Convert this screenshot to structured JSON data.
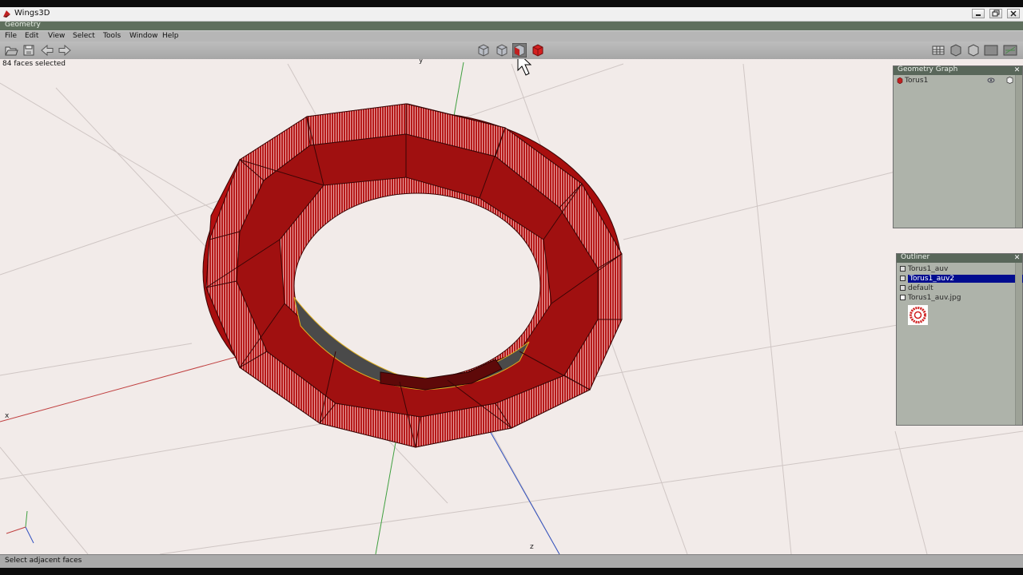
{
  "window": {
    "title": "Wings3D"
  },
  "mode": {
    "label": "Geometry"
  },
  "menu": [
    "File",
    "Edit",
    "View",
    "Select",
    "Tools",
    "Window",
    "Help"
  ],
  "toolbar": {
    "left_icons": [
      "open-icon",
      "save-icon",
      "undo-icon",
      "redo-icon"
    ],
    "selection_modes": [
      "vertex-mode",
      "edge-mode",
      "face-mode",
      "body-mode"
    ],
    "right_icons": [
      "grid-icon",
      "smooth-shade-icon",
      "wireframe-icon",
      "xray-icon",
      "axes-icon"
    ]
  },
  "viewport": {
    "selection_info": "84 faces selected",
    "axis_labels": {
      "x": "x",
      "y": "y",
      "z": "z"
    }
  },
  "geometry_graph": {
    "title": "Geometry Graph",
    "items": [
      {
        "label": "Torus1"
      }
    ]
  },
  "outliner": {
    "title": "Outliner",
    "items": [
      {
        "label": "Torus1_auv",
        "selected": false
      },
      {
        "label": "Torus1_auv2",
        "selected": true
      },
      {
        "label": "default",
        "selected": false
      },
      {
        "label": "Torus1_auv.jpg",
        "selected": false
      }
    ]
  },
  "status": {
    "text": "Select adjacent faces"
  },
  "colors": {
    "mesh_face": "#b40f10",
    "selected_row": "#000c8f",
    "panel_header": "#59675a",
    "viewport_bg": "#f2ebe9"
  }
}
